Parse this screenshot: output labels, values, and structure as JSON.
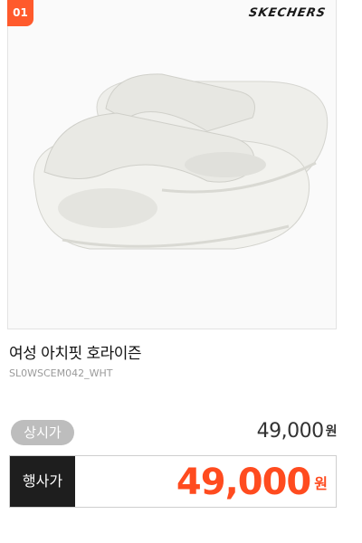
{
  "product": {
    "rank": "01",
    "brand": "SKECHERS",
    "title": "여성 아치핏 호라이즌",
    "sku": "SL0WSCEM042_WHT",
    "image_icon": "white-slide-sandals-image"
  },
  "pricing": {
    "list_label": "상시가",
    "list_price": "49,000",
    "list_currency": "원",
    "sale_label": "행사가",
    "sale_price": "49,000",
    "sale_currency": "원"
  },
  "colors": {
    "badge": "#ff5a2c",
    "sale_price": "#ff4b1f",
    "sale_label_bg": "#1e1e1e",
    "list_badge_bg": "#bdbdbd"
  }
}
